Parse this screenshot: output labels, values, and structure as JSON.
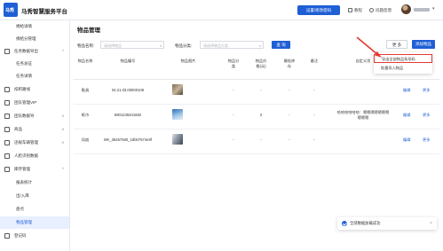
{
  "header": {
    "logo_text": "马秀",
    "app_title": "马秀智慧服务平台",
    "switch_button": "设置/修改密码",
    "links": [
      {
        "label": "教程",
        "icon": "book-icon"
      },
      {
        "label": "问题反馈",
        "icon": "help-icon"
      }
    ]
  },
  "sidebar": {
    "items": [
      {
        "label": "捐给详情",
        "type": "sub"
      },
      {
        "label": "捐给分管理",
        "type": "sub"
      },
      {
        "label": "任务数据导出",
        "type": "top",
        "icon": "export-icon"
      },
      {
        "label": "任务总征",
        "type": "sub"
      },
      {
        "label": "任务详情",
        "type": "sub"
      },
      {
        "label": "扣积路线",
        "type": "top",
        "icon": "route-icon"
      },
      {
        "label": "团队管理VIP",
        "type": "top",
        "icon": "team-icon"
      },
      {
        "label": "团队数据导",
        "type": "top",
        "icon": "data-icon"
      },
      {
        "label": "商品",
        "type": "top",
        "icon": "goods-icon"
      },
      {
        "label": "违规车辆管理",
        "type": "top",
        "icon": "car-icon"
      },
      {
        "label": "人脸识别数据",
        "type": "top",
        "icon": "face-icon"
      },
      {
        "label": "库存管理",
        "type": "top",
        "icon": "inventory-icon"
      },
      {
        "label": "报表统计",
        "type": "sub"
      },
      {
        "label": "出/入库",
        "type": "sub"
      },
      {
        "label": "盘点",
        "type": "sub"
      },
      {
        "label": "物品管理",
        "type": "sub",
        "active": true
      },
      {
        "label": "登记码",
        "type": "top",
        "icon": "qrcode-icon"
      }
    ]
  },
  "main": {
    "title": "物品管理",
    "filters": [
      {
        "label": "物品名称:",
        "placeholder": "请选择物品"
      },
      {
        "label": "物品分类:",
        "placeholder": "请选择物品分类"
      }
    ],
    "query_button": "查 询",
    "more_button": "更 多",
    "add_button": "添加物品",
    "dropdown": [
      {
        "label": "导出全部物品条形码",
        "highlighted": true
      },
      {
        "label": "批量导入物品",
        "highlighted": false
      }
    ],
    "columns": [
      "物品名称",
      "物品编号",
      "物品图片",
      "物品分类",
      "物品价格(元)",
      "最低库存",
      "备注",
      "自定义项",
      "操作"
    ],
    "rows": [
      {
        "name": "鞋具",
        "code": "04.21.03.00000108",
        "category": "-",
        "price": "-",
        "min_stock": "-",
        "note": "-",
        "custom": "",
        "ops": [
          "编辑",
          "更多"
        ]
      },
      {
        "name": "纸巾",
        "code": "6901236341682",
        "category": "-",
        "price": "2",
        "min_stock": "-",
        "note": "-",
        "custom": "哈哈哈哈哈哈：嗯嗯嗯嗯嗯嗯嗯嗯嗯嗯",
        "ops": [
          "编辑",
          "更多"
        ]
      },
      {
        "name": "风扇",
        "code": "MK_36457560_18b07574e9f",
        "category": "-",
        "price": "-",
        "min_stock": "-",
        "note": "-",
        "custom": "",
        "ops": [
          "编辑",
          "更多"
        ]
      }
    ]
  },
  "toast": {
    "message": "全部数据加载成功"
  },
  "colors": {
    "primary": "#1f5fd6",
    "annotation": "#e53935",
    "active_bg": "#e8efff"
  }
}
